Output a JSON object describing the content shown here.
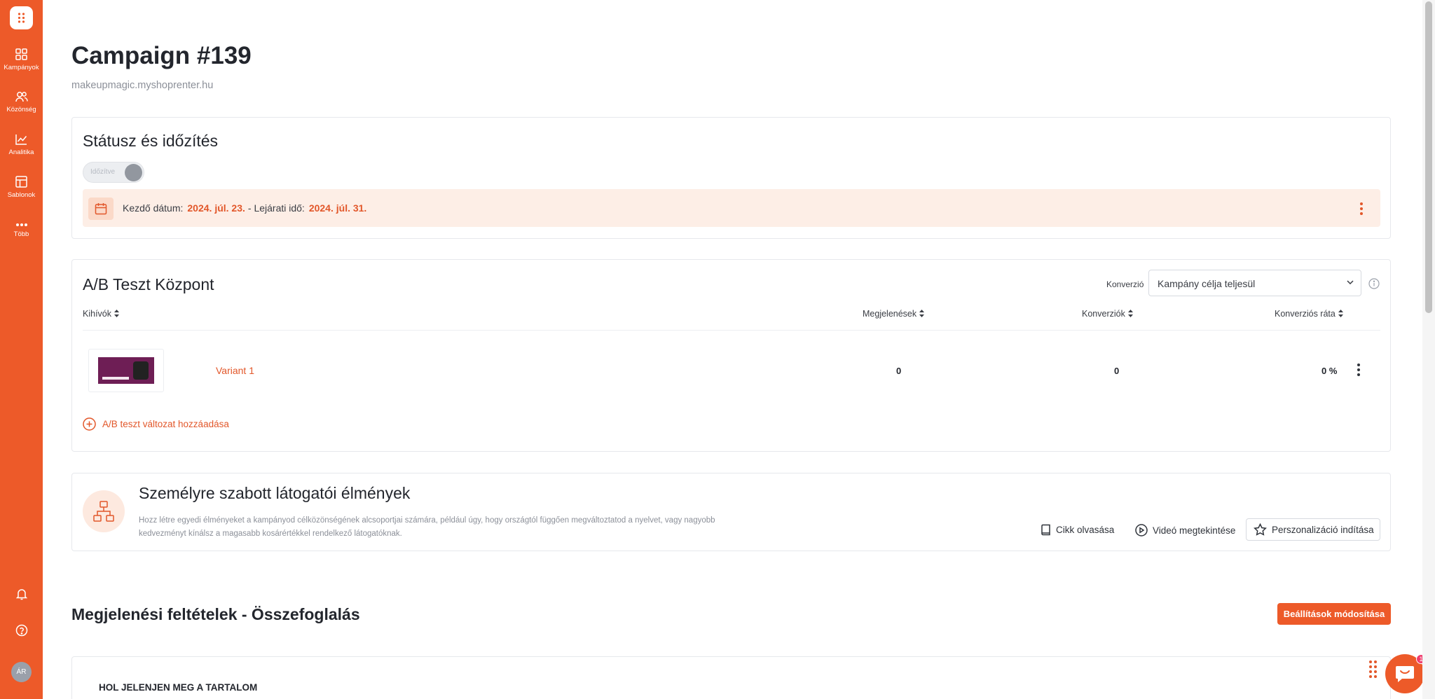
{
  "sidebar": {
    "items": [
      {
        "label": "Kampányok",
        "icon": "grid-icon"
      },
      {
        "label": "Közönség",
        "icon": "users-icon"
      },
      {
        "label": "Analitika",
        "icon": "chart-icon"
      },
      {
        "label": "Sablonok",
        "icon": "layout-icon"
      },
      {
        "label": "Több",
        "icon": "more-icon"
      }
    ],
    "avatar": "ÁR"
  },
  "page": {
    "title": "Campaign #139",
    "domain": "makeupmagic.myshoprenter.hu"
  },
  "status": {
    "title": "Státusz és időzítés",
    "toggle_label": "Időzítve",
    "start_label": "Kezdő dátum:",
    "start_value": "2024. júl. 23.",
    "end_label": "- Lejárati idő:",
    "end_value": "2024. júl. 31."
  },
  "ab": {
    "title": "A/B Teszt Központ",
    "conversion_label": "Konverzió",
    "conversion_value": "Kampány célja teljesül",
    "columns": [
      "Kihívók",
      "Megjelenések",
      "Konverziók",
      "Konverziós ráta"
    ],
    "rows": [
      {
        "name": "Variant 1",
        "impressions": "0",
        "conversions": "0",
        "rate": "0 %"
      }
    ],
    "add_label": "A/B teszt változat hozzáadása"
  },
  "personalization": {
    "title": "Személyre szabott látogatói élmények",
    "description": "Hozz létre egyedi élményeket a kampányod célközönségének alcsoportjai számára, például úgy, hogy országtól függően megváltoztatod a nyelvet, vagy nagyobb kedvezményt kínálsz a magasabb kosárértékkel rendelkező látogatóknak.",
    "read_label": "Cikk olvasása",
    "video_label": "Videó megtekintése",
    "start_label": "Perszonalizáció indítása"
  },
  "summary": {
    "title": "Megjelenési feltételek - Összefoglalás",
    "edit_label": "Beállítások módosítása",
    "where_title": "HOL JELENJEN MEG A TARTALOM"
  },
  "chat": {
    "badge": "1"
  },
  "colors": {
    "brand": "#ed5a29",
    "accent_text": "#e2572a"
  }
}
